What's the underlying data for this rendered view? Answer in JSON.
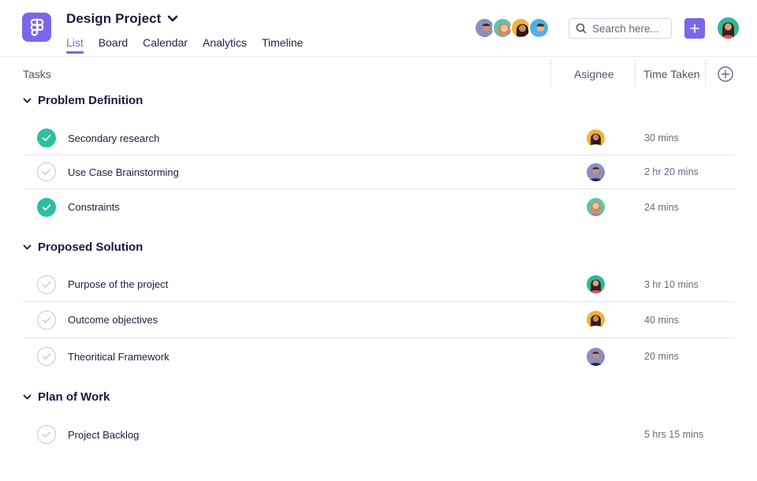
{
  "header": {
    "project_title": "Design Project",
    "tabs": [
      {
        "label": "List",
        "active": true
      },
      {
        "label": "Board",
        "active": false
      },
      {
        "label": "Calendar",
        "active": false
      },
      {
        "label": "Analytics",
        "active": false
      },
      {
        "label": "Timeline",
        "active": false
      }
    ],
    "search": {
      "placeholder": "Search here..."
    },
    "add_button_icon": "plus-icon"
  },
  "columns": {
    "tasks": "Tasks",
    "assignee": "Asignee",
    "time_taken": "Time Taken"
  },
  "sections": [
    {
      "title": "Problem Definition",
      "tasks": [
        {
          "name": "Secondary research",
          "done": true,
          "assignee": "avatar-4",
          "time": "30 mins"
        },
        {
          "name": "Use Case Brainstorming",
          "done": false,
          "assignee": "avatar-1",
          "time": "2 hr 20 mins"
        },
        {
          "name": "Constraints",
          "done": true,
          "assignee": "avatar-2",
          "time": "24 mins"
        }
      ]
    },
    {
      "title": "Proposed Solution",
      "tasks": [
        {
          "name": "Purpose of the project",
          "done": false,
          "assignee": "avatar-5",
          "time": "3 hr 10 mins"
        },
        {
          "name": "Outcome objectives",
          "done": false,
          "assignee": "avatar-4",
          "time": "40 mins"
        },
        {
          "name": "Theoritical Framework",
          "done": false,
          "assignee": "avatar-1",
          "time": "20 mins"
        }
      ]
    },
    {
      "title": "Plan of Work",
      "tasks": [
        {
          "name": "Project Backlog",
          "done": false,
          "assignee": "",
          "time": "5 hrs 15 mins"
        }
      ]
    }
  ],
  "colors": {
    "accent": "#7c66e8",
    "done": "#2bbf9e",
    "text": "#1a1740"
  }
}
